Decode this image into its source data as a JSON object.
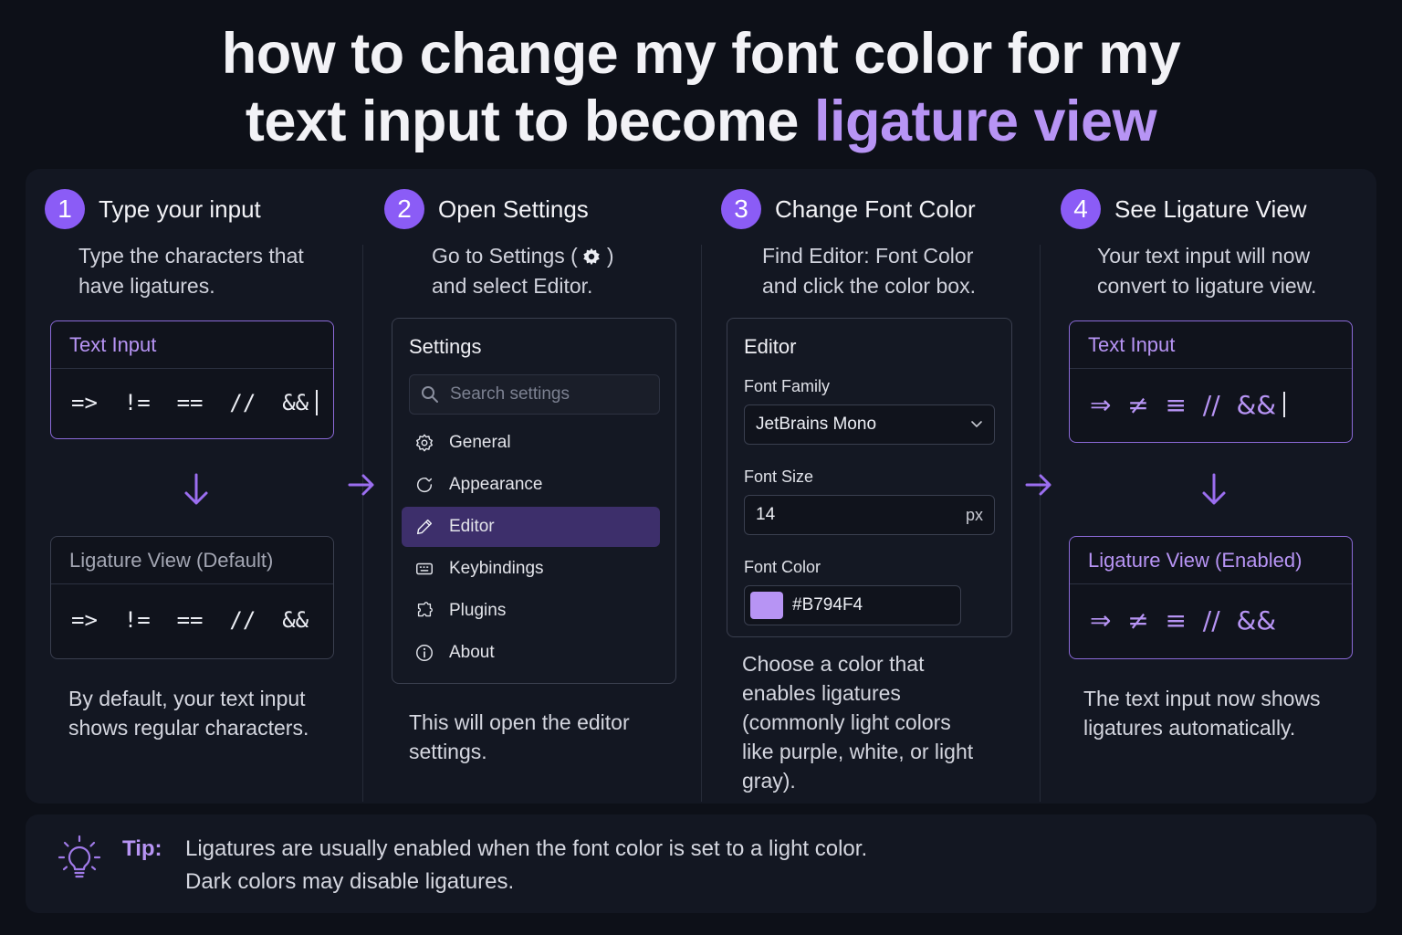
{
  "title": {
    "line1": "how to change my font color for my",
    "line2_plain": "text input to become ",
    "line2_accent": "ligature view"
  },
  "colors": {
    "accent": "#b794f4",
    "step_badge": "#8b5cf6",
    "active_menu": "#3d2f6b",
    "background": "#0d1018"
  },
  "steps": [
    {
      "num": "1",
      "title": "Type your input",
      "desc1": "Type the characters that",
      "desc2": "have ligatures.",
      "input_card": {
        "header": "Text Input",
        "value": "=>  !=  ==  //  &&"
      },
      "output_card": {
        "header": "Ligature View (Default)",
        "value": "=>  !=  ==  //  &&"
      },
      "caption1": "By default, your text input",
      "caption2": "shows regular characters."
    },
    {
      "num": "2",
      "title": "Open Settings",
      "desc1_a": "Go to Settings (",
      "desc1_b": ")",
      "desc2": "and select Editor.",
      "settings": {
        "title": "Settings",
        "search_placeholder": "Search settings",
        "items": [
          {
            "label": "General",
            "icon": "gear-icon"
          },
          {
            "label": "Appearance",
            "icon": "palette-icon"
          },
          {
            "label": "Editor",
            "icon": "pencil-icon",
            "active": true
          },
          {
            "label": "Keybindings",
            "icon": "keyboard-icon"
          },
          {
            "label": "Plugins",
            "icon": "puzzle-icon"
          },
          {
            "label": "About",
            "icon": "info-icon"
          }
        ]
      },
      "caption1": "This will open the editor",
      "caption2": "settings."
    },
    {
      "num": "3",
      "title": "Change Font Color",
      "desc1": "Find Editor: Font Color",
      "desc2": "and click the color box.",
      "editor": {
        "title": "Editor",
        "font_family_label": "Font Family",
        "font_family_value": "JetBrains Mono",
        "font_size_label": "Font Size",
        "font_size_value": "14",
        "font_size_unit": "px",
        "font_color_label": "Font Color",
        "font_color_value": "#B794F4"
      },
      "caption": [
        "Choose a color that",
        "enables ligatures",
        "(commonly light colors",
        "like purple, white, or light",
        "gray)."
      ]
    },
    {
      "num": "4",
      "title": "See Ligature View",
      "desc1": "Your text input will now",
      "desc2": "convert to ligature view.",
      "input_card": {
        "header": "Text Input",
        "value": "⇒  ≠  ≡  //  &&"
      },
      "output_card": {
        "header": "Ligature View (Enabled)",
        "value": "⇒  ≠  ≡  //  &&"
      },
      "caption1": "The text input now shows",
      "caption2": "ligatures automatically."
    }
  ],
  "tip": {
    "label": "Tip:",
    "line1": "Ligatures are usually enabled when the font color is set to a light color.",
    "line2": "Dark colors may disable ligatures.",
    "icon": "lightbulb-icon"
  }
}
